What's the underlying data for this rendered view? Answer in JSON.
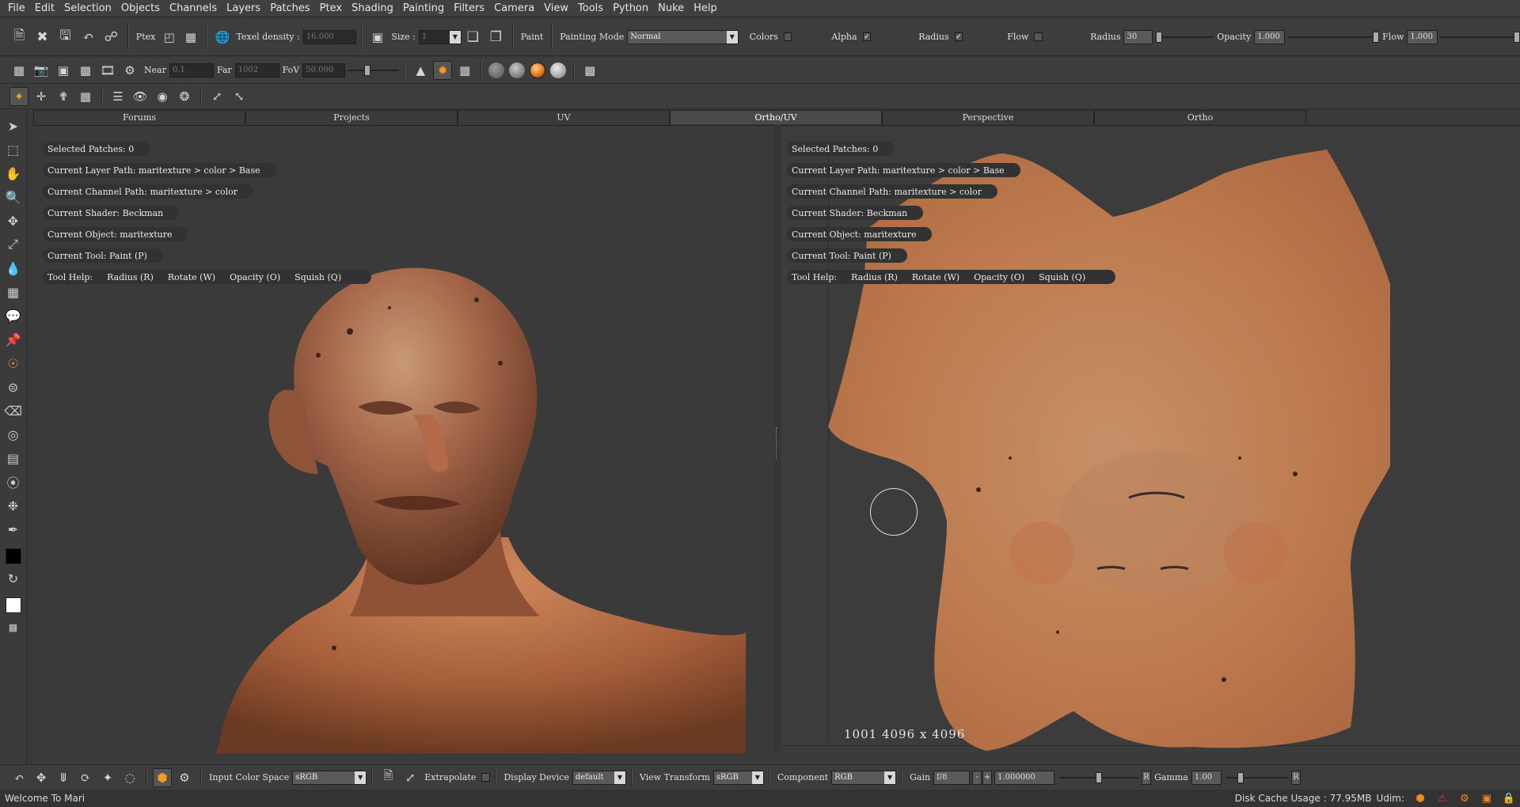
{
  "menu": [
    "File",
    "Edit",
    "Selection",
    "Objects",
    "Channels",
    "Layers",
    "Patches",
    "Ptex",
    "Shading",
    "Painting",
    "Filters",
    "Camera",
    "View",
    "Tools",
    "Python",
    "Nuke",
    "Help"
  ],
  "toolbar1": {
    "ptex_label": "Ptex",
    "texel_density_label": "Texel density :",
    "texel_density_value": "16.000",
    "size_label": "Size :",
    "size_value": "1",
    "paint_label": "Paint",
    "painting_mode_label": "Painting Mode",
    "painting_mode_value": "Normal",
    "colors_label": "Colors",
    "alpha_label": "Alpha",
    "radius_check_label": "Radius",
    "flow_check_label": "Flow",
    "radius_label": "Radius",
    "radius_value": "30",
    "opacity_label": "Opacity",
    "opacity_value": "1.000",
    "flow_label": "Flow",
    "flow_value": "1.000"
  },
  "toolbar2": {
    "near_label": "Near",
    "near_value": "0.1",
    "far_label": "Far",
    "far_value": "1002",
    "fov_label": "FoV",
    "fov_value": "50.000"
  },
  "tabs": [
    "Forums",
    "Projects",
    "UV",
    "Ortho/UV",
    "Perspective",
    "Ortho"
  ],
  "active_tab": "Ortho/UV",
  "hud": {
    "selected_patches": "Selected Patches: 0",
    "layer_path": "Current Layer Path: maritexture > color > Base",
    "channel_path": "Current Channel Path: maritexture > color",
    "shader": "Current Shader: Beckman",
    "object": "Current Object: maritexture",
    "tool": "Current Tool: Paint (P)",
    "help_label": "Tool Help:",
    "help_radius": "Radius (R)",
    "help_rotate": "Rotate (W)",
    "help_opacity": "Opacity (O)",
    "help_squish": "Squish (Q)"
  },
  "uv_readout": "1001  4096 x 4096",
  "bottom": {
    "input_color_space_label": "Input Color Space",
    "input_color_space_value": "sRGB",
    "extrapolate_label": "Extrapolate",
    "display_device_label": "Display Device",
    "display_device_value": "default",
    "view_transform_label": "View Transform",
    "view_transform_value": "sRGB",
    "component_label": "Component",
    "component_value": "RGB",
    "gain_label": "Gain",
    "gain_value": "f/8",
    "gain_minus": "-",
    "gain_plus": "+",
    "gain_exact": "1.000000",
    "reset_r": "R",
    "gamma_label": "Gamma",
    "gamma_value": "1.00",
    "reset_r2": "R"
  },
  "status": {
    "message": "Welcome To Mari",
    "disk_cache": "Disk Cache Usage : 77.95MB",
    "udim": "Udim:"
  },
  "colors": {
    "accent": "#f08a1c",
    "skin": "#c98255",
    "background": "#3a3a3a"
  }
}
